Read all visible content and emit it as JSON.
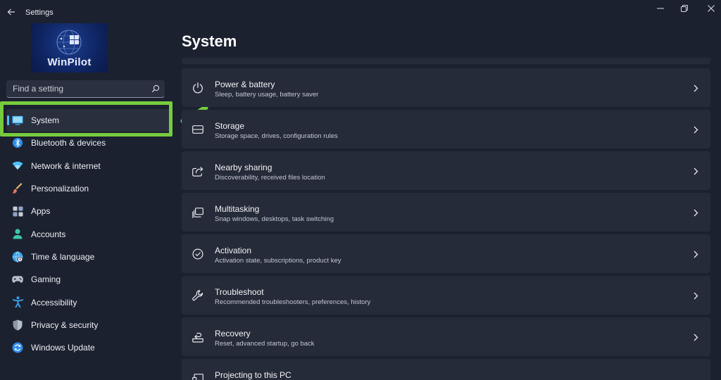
{
  "window": {
    "title": "Settings"
  },
  "logo": {
    "text": "WinPilot"
  },
  "search": {
    "placeholder": "Find a setting"
  },
  "sidebar": {
    "items": [
      {
        "label": "System",
        "icon": "monitor-icon",
        "selected": true
      },
      {
        "label": "Bluetooth & devices",
        "icon": "bluetooth-icon"
      },
      {
        "label": "Network & internet",
        "icon": "wifi-icon"
      },
      {
        "label": "Personalization",
        "icon": "brush-icon"
      },
      {
        "label": "Apps",
        "icon": "apps-icon"
      },
      {
        "label": "Accounts",
        "icon": "person-icon"
      },
      {
        "label": "Time & language",
        "icon": "globe-clock-icon"
      },
      {
        "label": "Gaming",
        "icon": "gamepad-icon"
      },
      {
        "label": "Accessibility",
        "icon": "accessibility-icon"
      },
      {
        "label": "Privacy & security",
        "icon": "shield-icon"
      },
      {
        "label": "Windows Update",
        "icon": "update-icon"
      }
    ]
  },
  "main": {
    "title": "System",
    "cards": [
      {
        "title": "Power & battery",
        "subtitle": "Sleep, battery usage, battery saver",
        "icon": "power-icon"
      },
      {
        "title": "Storage",
        "subtitle": "Storage space, drives, configuration rules",
        "icon": "storage-icon"
      },
      {
        "title": "Nearby sharing",
        "subtitle": "Discoverability, received files location",
        "icon": "share-icon"
      },
      {
        "title": "Multitasking",
        "subtitle": "Snap windows, desktops, task switching",
        "icon": "multitask-icon"
      },
      {
        "title": "Activation",
        "subtitle": "Activation state, subscriptions, product key",
        "icon": "check-circle-icon"
      },
      {
        "title": "Troubleshoot",
        "subtitle": "Recommended troubleshooters, preferences, history",
        "icon": "wrench-icon"
      },
      {
        "title": "Recovery",
        "subtitle": "Reset, advanced startup, go back",
        "icon": "recovery-icon"
      },
      {
        "title": "Projecting to this PC",
        "subtitle": "",
        "icon": "project-icon"
      }
    ]
  },
  "colors": {
    "background": "#1c2130",
    "card": "#262b39",
    "accent": "#4cc2ff",
    "annotation_green": "#76cc3e"
  }
}
